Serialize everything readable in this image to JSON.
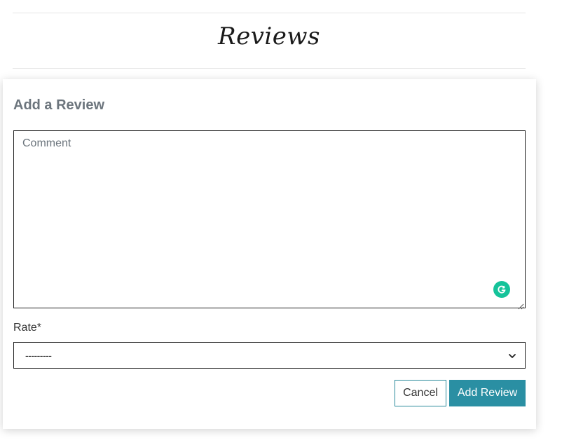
{
  "reviews_section": {
    "title": "Reviews"
  },
  "review_form": {
    "title": "Add a Review",
    "comment": {
      "placeholder": "Comment",
      "value": ""
    },
    "rate": {
      "label": "Rate*",
      "selected": "---------"
    },
    "cancel_label": "Cancel",
    "submit_label": "Add Review"
  },
  "colors": {
    "accent": "#2a8fa3",
    "grammarly": "#15c39a",
    "muted_text": "#6c757d"
  },
  "icons": {
    "grammarly": "grammarly-icon",
    "select": "chevron-down-icon",
    "resize": "resize-handle-icon"
  }
}
